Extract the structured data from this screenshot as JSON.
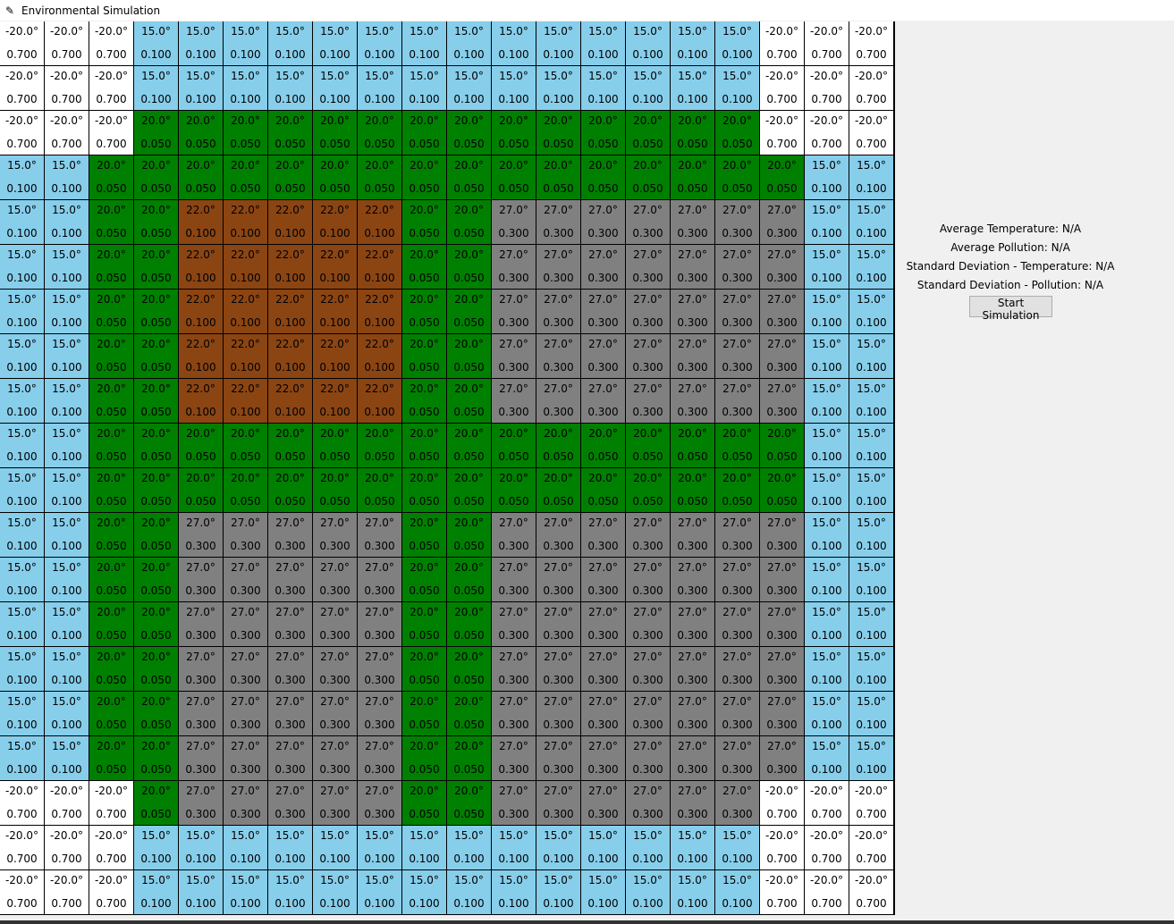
{
  "window": {
    "title": "Environmental Simulation",
    "icon": "feather-icon"
  },
  "grid": {
    "rows": 20,
    "cols": 20,
    "legend": {
      "W": {
        "color": "#ffffff",
        "temp": "-20.0°",
        "pollution": "0.700"
      },
      "B": {
        "color": "#87ceeb",
        "temp": "15.0°",
        "pollution": "0.100"
      },
      "G": {
        "color": "#008000",
        "temp": "20.0°",
        "pollution": "0.050"
      },
      "R": {
        "color": "#8b4513",
        "temp": "22.0°",
        "pollution": "0.100"
      },
      "Y": {
        "color": "#808080",
        "temp": "27.0°",
        "pollution": "0.300"
      }
    },
    "layout": [
      "WWWBBBBBBBBBBBBBBWWW",
      "WWWBBBBBBBBBBBBBBWWW",
      "WWWGGGGGGGGGGGGGGWWW",
      "BBGGGGGGGGGGGGGGGGBB",
      "BBGGRRRRRGGYYYYYYYBB",
      "BBGGRRRRRGGYYYYYYYBB",
      "BBGGRRRRRGGYYYYYYYBB",
      "BBGGRRRRRGGYYYYYYYBB",
      "BBGGRRRRRGGYYYYYYYBB",
      "BBGGGGGGGGGGGGGGGGBB",
      "BBGGGGGGGGGGGGGGGGBB",
      "BBGGYYYYYGGYYYYYYYBB",
      "BBGGYYYYYGGYYYYYYYBB",
      "BBGGYYYYYGGYYYYYYYBB",
      "BBGGYYYYYGGYYYYYYYBB",
      "BBGGYYYYYGGYYYYYYYBB",
      "BBGGYYYYYGGYYYYYYYBB",
      "WWWGYYYYYGGYYYYYYWWW",
      "WWWBBBBBBBBBBBBBBWWW",
      "WWWBBBBBBBBBBBBBBWWW"
    ]
  },
  "stats": {
    "avg_temperature": "Average Temperature: N/A",
    "avg_pollution": "Average Pollution: N/A",
    "std_temperature": "Standard Deviation - Temperature: N/A",
    "std_pollution": "Standard Deviation - Pollution: N/A"
  },
  "controls": {
    "start_label": "Start Simulation"
  }
}
